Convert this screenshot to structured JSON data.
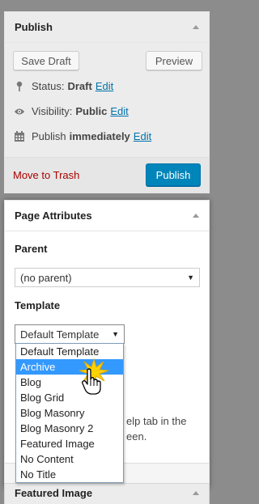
{
  "publish_box": {
    "title": "Publish",
    "save_draft": "Save Draft",
    "preview": "Preview",
    "status_label": "Status:",
    "status_value": "Draft",
    "visibility_label": "Visibility:",
    "visibility_value": "Public",
    "publish_label": "Publish",
    "publish_value": "immediately",
    "edit": "Edit",
    "move_to_trash": "Move to Trash",
    "publish_button": "Publish"
  },
  "attributes_box": {
    "title": "Page Attributes",
    "parent_label": "Parent",
    "parent_value": "(no parent)",
    "template_label": "Template",
    "template_value": "Default Template",
    "template_options": [
      "Default Template",
      "Archive",
      "Blog",
      "Blog Grid",
      "Blog Masonry",
      "Blog Masonry 2",
      "Featured Image",
      "No Content",
      "No Title"
    ],
    "selected_option": "Archive",
    "help_line1": "elp tab in the",
    "help_line2": "een."
  },
  "featured_box": {
    "title": "Featured Image"
  },
  "icons": {
    "status": "pin-icon",
    "visibility": "eye-icon",
    "publish_date": "calendar-icon",
    "cursor": "hand-pointer-icon",
    "click_burst": "click-burst-icon"
  }
}
